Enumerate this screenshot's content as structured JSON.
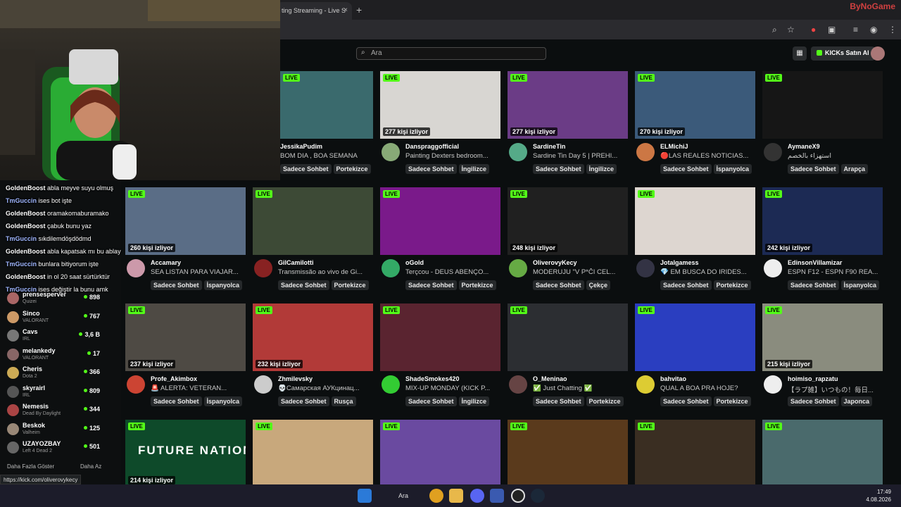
{
  "browser": {
    "tab_title": "ting Streaming - Live S",
    "tab_close": "×",
    "new_tab": "+",
    "watermark": "ByNoGame"
  },
  "header": {
    "search_placeholder": "Ara",
    "kicks_button": "KICKs Satın Al"
  },
  "streams": [
    {
      "name": "JessikaPudim",
      "title": "BOM DIA , BOA SEMANA",
      "viewers": "",
      "tags": [
        "Sadece Sohbet",
        "Portekizce"
      ],
      "live": "LIVE",
      "thumb": "#3a6a6d",
      "avatar": "#d96"
    },
    {
      "name": "Danspraggofficial",
      "title": "Painting Dexters bedroom...",
      "viewers": "277 kişi izliyor",
      "tags": [
        "Sadece Sohbet",
        "İngilizce"
      ],
      "live": "LIVE",
      "thumb": "#d8d6d2",
      "avatar": "#8a7"
    },
    {
      "name": "SardineTin",
      "title": "Sardine Tin Day 5 | PREHI...",
      "viewers": "277 kişi izliyor",
      "tags": [
        "Sadece Sohbet",
        "İngilizce"
      ],
      "live": "LIVE",
      "thumb": "#6b3c86",
      "avatar": "#5a8"
    },
    {
      "name": "ELMichiJ",
      "title": "🔴LAS REALES NOTICIAS...",
      "viewers": "270 kişi izliyor",
      "tags": [
        "Sadece Sohbet",
        "İspanyolca"
      ],
      "live": "LIVE",
      "thumb": "#3b5a7a",
      "avatar": "#c74"
    },
    {
      "name": "AymaneX9",
      "title": "استهزاء بالخصم",
      "viewers": "",
      "tags": [
        "Sadece Sohbet",
        "Arapça"
      ],
      "live": "LIVE",
      "thumb": "#161616",
      "avatar": "#333"
    },
    {
      "name": "Accamary",
      "title": "SEA LISTAN PARA VIAJAR...",
      "viewers": "260 kişi izliyor",
      "tags": [
        "Sadece Sohbet",
        "İspanyolca"
      ],
      "live": "LIVE",
      "thumb": "#5a6d86",
      "avatar": "#c9a"
    },
    {
      "name": "GilCamilotti",
      "title": "Transmissão ao vivo de Gi...",
      "viewers": "",
      "tags": [
        "Sadece Sohbet",
        "Portekizce"
      ],
      "live": "LIVE",
      "thumb": "#3d4a36",
      "avatar": "#822"
    },
    {
      "name": "oGold",
      "title": "Terçcou - DEUS ABENÇO...",
      "viewers": "",
      "tags": [
        "Sadece Sohbet",
        "Portekizce"
      ],
      "live": "LIVE",
      "thumb": "#7a1a8a",
      "avatar": "#3a6"
    },
    {
      "name": "OliverovyKecy",
      "title": "MODERUJU \"V P*ČI CEL...",
      "viewers": "248 kişi izliyor",
      "tags": [
        "Sadece Sohbet",
        "Çekçe"
      ],
      "live": "LIVE",
      "thumb": "#202020",
      "avatar": "#6a4"
    },
    {
      "name": "Jotalgamess",
      "title": "💎 EM BUSCA DO IRIDES...",
      "viewers": "",
      "tags": [
        "Sadece Sohbet",
        "Portekizce"
      ],
      "live": "LIVE",
      "thumb": "#ddd6d0",
      "avatar": "#334"
    },
    {
      "name": "EdinsonVillamizar",
      "title": "ESPN F12 - ESPN F90 REA...",
      "viewers": "242 kişi izliyor",
      "tags": [
        "Sadece Sohbet",
        "İspanyolca"
      ],
      "live": "LIVE",
      "thumb": "#1c2a54",
      "avatar": "#eee"
    },
    {
      "name": "Profe_Akimbox",
      "title": "🚨 ALERTA: VETERAN...",
      "viewers": "237 kişi izliyor",
      "tags": [
        "Sadece Sohbet",
        "İspanyolca"
      ],
      "live": "LIVE",
      "thumb": "#4e4a44",
      "avatar": "#c43"
    },
    {
      "name": "Zhmilevsky",
      "title": "💀Самарская АУКцинац...",
      "viewers": "232 kişi izliyor",
      "tags": [
        "Sadece Sohbet",
        "Rusça"
      ],
      "live": "LIVE",
      "thumb": "#b23a38",
      "avatar": "#ccc"
    },
    {
      "name": "ShadeSmokes420",
      "title": "MIX-UP MONDAY (KICK P...",
      "viewers": "",
      "tags": [
        "Sadece Sohbet",
        "İngilizce"
      ],
      "live": "LIVE",
      "thumb": "#5a2430",
      "avatar": "#3c3"
    },
    {
      "name": "O_Meninao",
      "title": "✅ Just Chatting ✅",
      "viewers": "",
      "tags": [
        "Sadece Sohbet",
        "Portekizce"
      ],
      "live": "LIVE",
      "thumb": "#2c2e32",
      "avatar": "#644"
    },
    {
      "name": "bahvitao",
      "title": "QUAL A BOA PRA HOJE?",
      "viewers": "",
      "tags": [
        "Sadece Sohbet",
        "Portekizce"
      ],
      "live": "LIVE",
      "thumb": "#2a3ec0",
      "avatar": "#dc3"
    },
    {
      "name": "hoimiso_rapzatu",
      "title": "【ラプ雑】いつもの！毎日...",
      "viewers": "215 kişi izliyor",
      "tags": [
        "Sadece Sohbet",
        "Japonca"
      ],
      "live": "LIVE",
      "thumb": "#8a8c7e",
      "avatar": "#eee"
    },
    {
      "name": "",
      "title": "",
      "viewers": "214 kişi izliyor",
      "tags": [],
      "live": "LIVE",
      "thumb": "#0e4a2a",
      "avatar": "#000",
      "overlay": "FUTURE NATION"
    },
    {
      "name": "",
      "title": "",
      "viewers": "",
      "tags": [],
      "live": "LIVE",
      "thumb": "#c8a87c",
      "avatar": "#000"
    },
    {
      "name": "",
      "title": "",
      "viewers": "",
      "tags": [],
      "live": "LIVE",
      "thumb": "#6a4aa0",
      "avatar": "#000"
    },
    {
      "name": "",
      "title": "",
      "viewers": "",
      "tags": [],
      "live": "LIVE",
      "thumb": "#5a3a1c",
      "avatar": "#000"
    },
    {
      "name": "",
      "title": "",
      "viewers": "",
      "tags": [],
      "live": "LIVE",
      "thumb": "#3a2e22",
      "avatar": "#000"
    },
    {
      "name": "",
      "title": "",
      "viewers": "",
      "tags": [],
      "live": "LIVE",
      "thumb": "#4a6a6c",
      "avatar": "#000"
    }
  ],
  "sidebar": {
    "items": [
      {
        "name": "prensesperver",
        "game": "Quizei",
        "count": "898",
        "color": "#a66"
      },
      {
        "name": "Sinco",
        "game": "VALORANT",
        "count": "767",
        "color": "#c96"
      },
      {
        "name": "Cavs",
        "game": "IRL",
        "count": "3,6 B",
        "color": "#777"
      },
      {
        "name": "melankedy",
        "game": "VALORANT",
        "count": "17",
        "color": "#866"
      },
      {
        "name": "Cheris",
        "game": "Dota 2",
        "count": "366",
        "color": "#ca5"
      },
      {
        "name": "skyrairl",
        "game": "IRL",
        "count": "809",
        "color": "#555"
      },
      {
        "name": "Nemesis",
        "game": "Dead By Daylight",
        "count": "344",
        "color": "#a44"
      },
      {
        "name": "Beskok",
        "game": "Valheim",
        "count": "125",
        "color": "#987"
      },
      {
        "name": "UZAYOZBAY",
        "game": "Left 4 Dead 2",
        "count": "501",
        "color": "#666"
      }
    ],
    "show_more": "Daha Fazla Göster",
    "show_less": "Daha Az"
  },
  "chat": [
    {
      "user": "GoldenBoost",
      "msg": "abla meyve suyu olmuş",
      "c": "u1"
    },
    {
      "user": "TmGuccin",
      "msg": "ises bot işte",
      "c": "u2"
    },
    {
      "user": "GoldenBoost",
      "msg": "oramakomaburamako",
      "c": "u1"
    },
    {
      "user": "GoldenBoost",
      "msg": "çabuk bunu yaz",
      "c": "u1"
    },
    {
      "user": "TmGuccin",
      "msg": "sıkdilemdöşdödmd",
      "c": "u2"
    },
    {
      "user": "GoldenBoost",
      "msg": "abla kapatsak mı bu ablay",
      "c": "u1"
    },
    {
      "user": "TmGuccin",
      "msg": "bunlara bitiyorum işte",
      "c": "u2"
    },
    {
      "user": "GoldenBoost",
      "msg": "in ol 20 saat sürtürktür",
      "c": "u1"
    },
    {
      "user": "TmGuccin",
      "msg": "ises değiştir la bunu amk",
      "c": "u2"
    }
  ],
  "status_url": "https://kick.com/oliverovykecy",
  "taskbar": {
    "search_label": "Ara",
    "time": "17:49",
    "date": "4.08.2026"
  },
  "colors": {
    "accent": "#53fc18",
    "background": "#0b0e0f",
    "tag_bg": "#26292b"
  }
}
